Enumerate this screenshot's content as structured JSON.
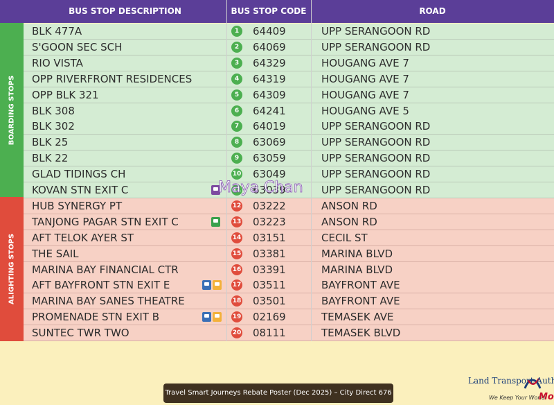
{
  "headers": {
    "description": "BUS STOP DESCRIPTION",
    "code": "BUS STOP CODE",
    "road": "ROAD"
  },
  "sections": {
    "boarding": "BOARDING STOPS",
    "alighting": "ALIGHTING STOPS"
  },
  "stops": [
    {
      "num": "1",
      "desc": "BLK 477A",
      "code": "64409",
      "road": "UPP SERANGOON RD",
      "icons": []
    },
    {
      "num": "2",
      "desc": "S'GOON SEC SCH",
      "code": "64069",
      "road": "UPP SERANGOON RD",
      "icons": []
    },
    {
      "num": "3",
      "desc": "RIO VISTA",
      "code": "64329",
      "road": "HOUGANG AVE 7",
      "icons": []
    },
    {
      "num": "4",
      "desc": "OPP RIVERFRONT RESIDENCES",
      "code": "64319",
      "road": "HOUGANG AVE 7",
      "icons": []
    },
    {
      "num": "5",
      "desc": "OPP BLK 321",
      "code": "64309",
      "road": "HOUGANG AVE 7",
      "icons": []
    },
    {
      "num": "6",
      "desc": "BLK 308",
      "code": "64241",
      "road": "HOUGANG AVE 5",
      "icons": []
    },
    {
      "num": "7",
      "desc": "BLK 302",
      "code": "64019",
      "road": "UPP SERANGOON RD",
      "icons": []
    },
    {
      "num": "8",
      "desc": "BLK 25",
      "code": "63069",
      "road": "UPP SERANGOON RD",
      "icons": []
    },
    {
      "num": "9",
      "desc": "BLK 22",
      "code": "63059",
      "road": "UPP SERANGOON RD",
      "icons": []
    },
    {
      "num": "10",
      "desc": "GLAD TIDINGS CH",
      "code": "63049",
      "road": "UPP SERANGOON RD",
      "icons": []
    },
    {
      "num": "11",
      "desc": "KOVAN STN EXIT C",
      "code": "63039",
      "road": "UPP SERANGOON RD",
      "icons": [
        "pu"
      ]
    },
    {
      "num": "12",
      "desc": "HUB SYNERGY PT",
      "code": "03222",
      "road": "ANSON RD",
      "icons": []
    },
    {
      "num": "13",
      "desc": "TANJONG PAGAR STN EXIT C",
      "code": "03223",
      "road": "ANSON RD",
      "icons": [
        "gr"
      ]
    },
    {
      "num": "14",
      "desc": "AFT TELOK AYER ST",
      "code": "03151",
      "road": "CECIL ST",
      "icons": []
    },
    {
      "num": "15",
      "desc": "THE SAIL",
      "code": "03381",
      "road": "MARINA BLVD",
      "icons": []
    },
    {
      "num": "16",
      "desc": "MARINA BAY FINANCIAL CTR",
      "code": "03391",
      "road": "MARINA BLVD",
      "icons": []
    },
    {
      "num": "17",
      "desc": "AFT BAYFRONT STN EXIT E",
      "code": "03511",
      "road": "BAYFRONT AVE",
      "icons": [
        "b",
        "y"
      ]
    },
    {
      "num": "18",
      "desc": "MARINA BAY SANES THEATRE",
      "code": "03501",
      "road": "BAYFRONT AVE",
      "icons": []
    },
    {
      "num": "19",
      "desc": "PROMENADE STN EXIT B",
      "code": "02169",
      "road": "TEMASEK AVE",
      "icons": [
        "b",
        "y"
      ]
    },
    {
      "num": "20",
      "desc": "SUNTEC TWR TWO",
      "code": "08111",
      "road": "TEMASEK BLVD",
      "icons": []
    }
  ],
  "watermark": "Maya Chan",
  "caption": "Travel Smart Journeys Rebate Poster (Dec 2025) – City Direct 676",
  "lta": {
    "name": "Land Transport Auth",
    "tagline": "We Keep Your World",
    "tagline_end": "Mo"
  },
  "colors": {
    "header": "#5b3e98",
    "boarding": "#4caf50",
    "alighting": "#e04c3c",
    "boarding_row": "#d4ecd3",
    "alighting_row": "#f7d1c5"
  }
}
